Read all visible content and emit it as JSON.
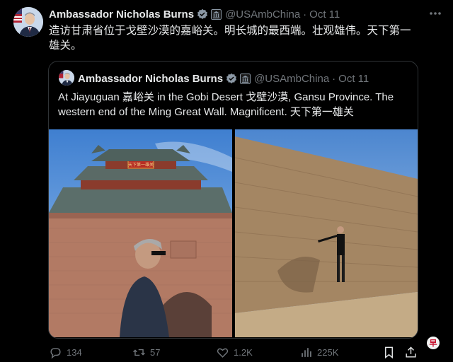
{
  "tweet": {
    "author_name": "Ambassador Nicholas Burns",
    "handle": "@USAmbChina",
    "separator": "·",
    "date": "Oct 11",
    "text": "造访甘肃省位于戈壁沙漠的嘉峪关。明长城的最西端。壮观雄伟。天下第一雄关。"
  },
  "quoted_tweet": {
    "author_name": "Ambassador Nicholas Burns",
    "handle": "@USAmbChina",
    "separator": "·",
    "date": "Oct 11",
    "text": "At Jiayuguan 嘉峪关 in the Gobi Desert 戈壁沙漠, Gansu Province.  The western end of the Ming Great Wall.  Magnificent. 天下第一雄关",
    "gate_plaque": "天下第一雄关"
  },
  "actions": {
    "replies": "134",
    "reposts": "57",
    "likes": "1.2K",
    "views": "225K"
  },
  "watermark": "早",
  "colors": {
    "background": "#000000",
    "text": "#e7e9ea",
    "muted": "#71767b",
    "verified": "#1d9bf0",
    "border": "#2f3336"
  },
  "icons": [
    "more-icon",
    "verified-badge-icon",
    "government-badge-icon",
    "reply-icon",
    "repost-icon",
    "like-icon",
    "views-icon",
    "bookmark-icon",
    "share-icon"
  ]
}
